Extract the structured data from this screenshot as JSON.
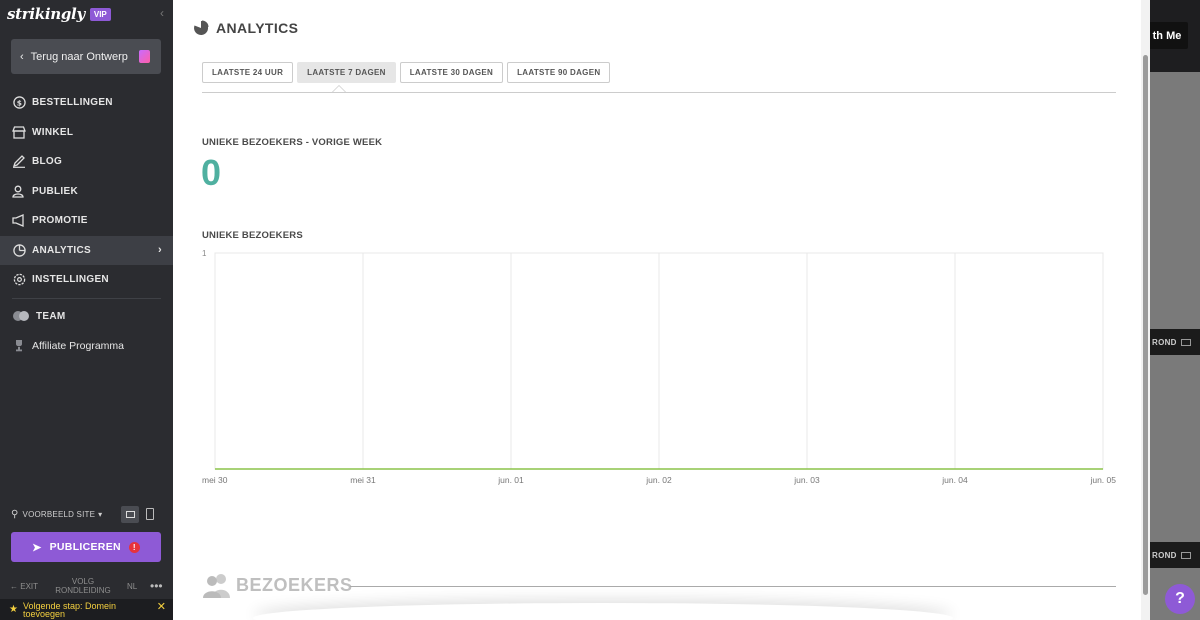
{
  "sidebar": {
    "brand": "strikingly",
    "vip_badge": "VIP",
    "back_button": "Terug naar Ontwerp",
    "items": [
      {
        "label": "BESTELLINGEN",
        "icon": "dollar-circle-icon"
      },
      {
        "label": "WINKEL",
        "icon": "store-icon"
      },
      {
        "label": "BLOG",
        "icon": "pen-icon"
      },
      {
        "label": "PUBLIEK",
        "icon": "people-icon"
      },
      {
        "label": "PROMOTIE",
        "icon": "megaphone-icon"
      },
      {
        "label": "ANALYTICS",
        "icon": "pie-chart-icon",
        "active": true
      },
      {
        "label": "INSTELLINGEN",
        "icon": "gear-icon"
      },
      {
        "label": "TEAM",
        "icon": "team-icon"
      },
      {
        "label": "Affiliate Programma",
        "icon": "trophy-icon"
      }
    ],
    "preview_label": "VOORBEELD SITE",
    "publish_label": "PUBLICEREN",
    "publish_alert": "!",
    "exit_label": "EXIT",
    "tour_label_1": "VOLG",
    "tour_label_2": "RONDLEIDING",
    "lang_label": "NL",
    "more_label": "•••",
    "next_step_line1": "Volgende stap: Domein",
    "next_step_line2": "toevoegen"
  },
  "background_site": {
    "button_label": "th Me",
    "tag_label": "ROND"
  },
  "help_label": "?",
  "analytics": {
    "title": "ANALYTICS",
    "tabs": [
      {
        "label": "LAATSTE 24 UUR",
        "active": false
      },
      {
        "label": "LAATSTE 7 DAGEN",
        "active": true
      },
      {
        "label": "LAATSTE 30 DAGEN",
        "active": false
      },
      {
        "label": "LAATSTE 90 DAGEN",
        "active": false
      }
    ],
    "unique_last_week_label": "UNIEKE BEZOEKERS - VORIGE WEEK",
    "unique_last_week_value": "0",
    "chart_label": "UNIEKE BEZOEKERS",
    "visitors_heading": "BEZOEKERS"
  },
  "colors": {
    "accent": "#8e5ad6",
    "teal": "#4fb0a0",
    "line": "#8bc34a"
  },
  "chart_data": {
    "type": "line",
    "x": [
      "mei 30",
      "mei 31",
      "jun. 01",
      "jun. 02",
      "jun. 03",
      "jun. 04",
      "jun. 05"
    ],
    "series": [
      {
        "values": [
          0,
          0,
          0,
          0,
          0,
          0,
          0
        ]
      }
    ],
    "y_tick_labels": [
      "1"
    ],
    "ylim": [
      0,
      1
    ],
    "grid": true
  }
}
